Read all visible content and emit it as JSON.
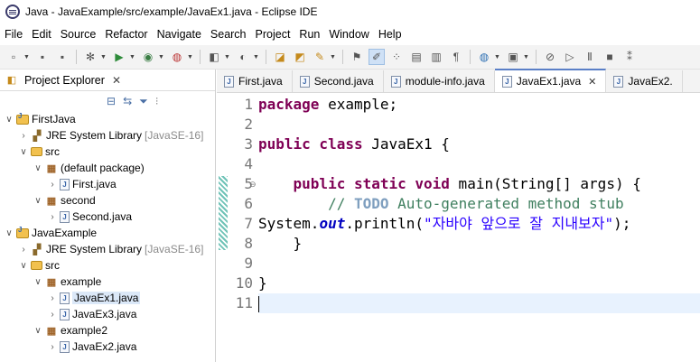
{
  "window": {
    "title": "Java - JavaExample/src/example/JavaEx1.java - Eclipse IDE"
  },
  "menu": [
    "File",
    "Edit",
    "Source",
    "Refactor",
    "Navigate",
    "Search",
    "Project",
    "Run",
    "Window",
    "Help"
  ],
  "project_explorer": {
    "title": "Project Explorer",
    "close": "✕",
    "tree": [
      {
        "label": "FirstJava",
        "icon": "project-icon",
        "indent": 0,
        "chevron": "∨"
      },
      {
        "label": "JRE System Library",
        "suffix": "[JavaSE-16]",
        "icon": "library-icon",
        "indent": 1,
        "chevron": "›"
      },
      {
        "label": "src",
        "icon": "source-folder-icon",
        "indent": 1,
        "chevron": "∨"
      },
      {
        "label": "(default package)",
        "icon": "package-icon",
        "indent": 2,
        "chevron": "∨"
      },
      {
        "label": "First.java",
        "icon": "java-file-icon",
        "indent": 3,
        "chevron": "›"
      },
      {
        "label": "second",
        "icon": "package-icon",
        "indent": 2,
        "chevron": "∨"
      },
      {
        "label": "Second.java",
        "icon": "java-file-icon",
        "indent": 3,
        "chevron": "›"
      },
      {
        "label": "JavaExample",
        "icon": "project-icon",
        "indent": 0,
        "chevron": "∨"
      },
      {
        "label": "JRE System Library",
        "suffix": "[JavaSE-16]",
        "icon": "library-icon",
        "indent": 1,
        "chevron": "›"
      },
      {
        "label": "src",
        "icon": "source-folder-icon",
        "indent": 1,
        "chevron": "∨"
      },
      {
        "label": "example",
        "icon": "package-icon",
        "indent": 2,
        "chevron": "∨"
      },
      {
        "label": "JavaEx1.java",
        "icon": "java-file-icon",
        "indent": 3,
        "chevron": "›",
        "selected": true
      },
      {
        "label": "JavaEx3.java",
        "icon": "java-file-icon",
        "indent": 3,
        "chevron": "›"
      },
      {
        "label": "example2",
        "icon": "package-icon",
        "indent": 2,
        "chevron": "∨"
      },
      {
        "label": "JavaEx2.java",
        "icon": "java-file-icon",
        "indent": 3,
        "chevron": "›"
      }
    ]
  },
  "editor": {
    "tabs": [
      {
        "label": "First.java",
        "active": false
      },
      {
        "label": "Second.java",
        "active": false
      },
      {
        "label": "module-info.java",
        "active": false
      },
      {
        "label": "JavaEx1.java",
        "active": true,
        "close": "✕"
      },
      {
        "label": "JavaEx2.",
        "active": false
      }
    ],
    "line_numbers": [
      "1",
      "2",
      "3",
      "4",
      "5",
      "6",
      "7",
      "8",
      "9",
      "10",
      "11"
    ],
    "lines": [
      [
        {
          "t": "package",
          "c": "kw"
        },
        {
          "t": " example;",
          "c": ""
        }
      ],
      [],
      [
        {
          "t": "public class",
          "c": "kw"
        },
        {
          "t": " JavaEx1 {",
          "c": ""
        }
      ],
      [],
      [
        {
          "t": "    ",
          "c": ""
        },
        {
          "t": "public static void",
          "c": "kw"
        },
        {
          "t": " main(String[] args) {",
          "c": ""
        }
      ],
      [
        {
          "t": "        ",
          "c": ""
        },
        {
          "t": "// ",
          "c": "cm"
        },
        {
          "t": "TODO",
          "c": "todo"
        },
        {
          "t": " Auto-generated method stub",
          "c": "cm"
        }
      ],
      [
        {
          "t": "System.",
          "c": ""
        },
        {
          "t": "out",
          "c": "fld"
        },
        {
          "t": ".println(",
          "c": ""
        },
        {
          "t": "\"자바야 앞으로 잘 지내보자\"",
          "c": "str"
        },
        {
          "t": ");",
          "c": ""
        }
      ],
      [
        {
          "t": "    }",
          "c": ""
        }
      ],
      [],
      [
        {
          "t": "}",
          "c": ""
        }
      ],
      []
    ]
  },
  "colors": {
    "keyword": "#7f0055",
    "comment": "#3f7f5f",
    "string": "#2a00ff",
    "field": "#0000c0",
    "selection": "#dbe8f8"
  }
}
